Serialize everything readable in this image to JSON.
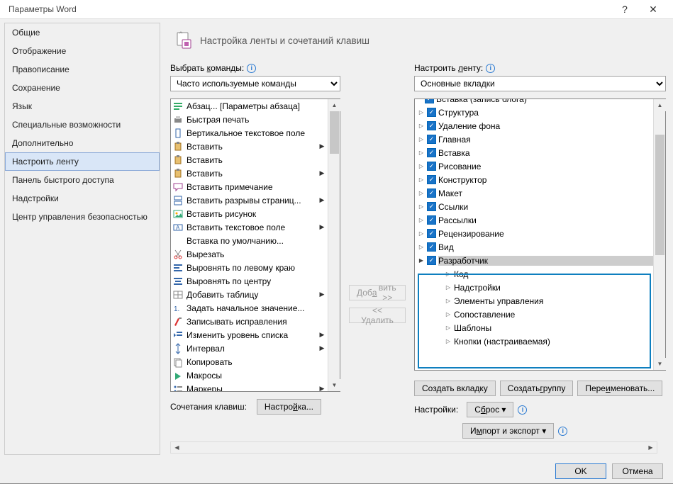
{
  "window": {
    "title": "Параметры Word",
    "help": "?",
    "close": "✕"
  },
  "sidebar": {
    "items": [
      {
        "label": "Общие"
      },
      {
        "label": "Отображение"
      },
      {
        "label": "Правописание"
      },
      {
        "label": "Сохранение"
      },
      {
        "label": "Язык"
      },
      {
        "label": "Специальные возможности"
      },
      {
        "label": "Дополнительно"
      },
      {
        "label": "Настроить ленту"
      },
      {
        "label": "Панель быстрого доступа"
      },
      {
        "label": "Надстройки"
      },
      {
        "label": "Центр управления безопасностью"
      }
    ],
    "selected_index": 7
  },
  "heading": "Настройка ленты и сочетаний клавиш",
  "left": {
    "label_before": "Выбрать ",
    "label_under": "к",
    "label_after": "оманды:",
    "combo": "Часто используемые команды",
    "commands": [
      {
        "icon": "para",
        "label": "Абзац... [Параметры абзаца]"
      },
      {
        "icon": "print",
        "label": "Быстрая печать"
      },
      {
        "icon": "vtext",
        "label": "Вертикальное текстовое поле"
      },
      {
        "icon": "paste",
        "label": "Вставить",
        "hasMenu": true
      },
      {
        "icon": "paste",
        "label": "Вставить"
      },
      {
        "icon": "paste",
        "label": "Вставить",
        "hasMenu": true
      },
      {
        "icon": "comment",
        "label": "Вставить примечание"
      },
      {
        "icon": "pgbreak",
        "label": "Вставить разрывы страниц...",
        "hasMenu": true
      },
      {
        "icon": "img",
        "label": "Вставить рисунок"
      },
      {
        "icon": "textbox",
        "label": "Вставить текстовое поле",
        "hasMenu": true
      },
      {
        "icon": "blank",
        "label": "Вставка по умолчанию..."
      },
      {
        "icon": "cut",
        "label": "Вырезать"
      },
      {
        "icon": "alignl",
        "label": "Выровнять по левому краю"
      },
      {
        "icon": "alignc",
        "label": "Выровнять по центру"
      },
      {
        "icon": "table",
        "label": "Добавить таблицу",
        "hasMenu": true
      },
      {
        "icon": "num",
        "label": "Задать начальное значение..."
      },
      {
        "icon": "track",
        "label": "Записывать исправления"
      },
      {
        "icon": "indent",
        "label": "Изменить уровень списка",
        "hasMenu": true
      },
      {
        "icon": "spacing",
        "label": "Интервал",
        "hasMenu": true
      },
      {
        "icon": "copy",
        "label": "Копировать"
      },
      {
        "icon": "macro",
        "label": "Макросы"
      },
      {
        "icon": "bullet",
        "label": "Маркеры",
        "hasMenu": true
      }
    ],
    "kb_label": "Сочетания клавиш:",
    "kb_button_before": "Настро",
    "kb_button_under": "й",
    "kb_button_after": "ка..."
  },
  "mid": {
    "add_before": "Доб",
    "add_under": "а",
    "add_after": "вить >>",
    "remove": "<< Удалить"
  },
  "right": {
    "label_before": "Настроить ",
    "label_under": "л",
    "label_after": "енту:",
    "combo": "Основные вкладки",
    "top_partial": "Вставка (запись блога)",
    "tree": [
      {
        "label": "Структура"
      },
      {
        "label": "Удаление фона"
      },
      {
        "label": "Главная"
      },
      {
        "label": "Вставка"
      },
      {
        "label": "Рисование"
      },
      {
        "label": "Конструктор"
      },
      {
        "label": "Макет"
      },
      {
        "label": "Ссылки"
      },
      {
        "label": "Рассылки"
      },
      {
        "label": "Рецензирование"
      },
      {
        "label": "Вид"
      }
    ],
    "selected": {
      "label": "Разработчик",
      "children": [
        "Код",
        "Надстройки",
        "Элементы управления",
        "Сопоставление",
        "Шаблоны",
        "Кнопки (настраиваемая)"
      ]
    },
    "btn1_before": "Создать вкла",
    "btn1_under": "д",
    "btn1_after": "ку",
    "btn2_before": "Создать ",
    "btn2_under": "г",
    "btn2_after": "руппу",
    "btn3_before": "Пере",
    "btn3_under": "и",
    "btn3_after": "меновать...",
    "settings_label": "Настройки:",
    "reset_before": "С",
    "reset_under": "б",
    "reset_after": "рос ▾",
    "import_before": "И",
    "import_under": "м",
    "import_after": "порт и экспорт ▾"
  },
  "footer": {
    "ok": "OK",
    "cancel": "Отмена"
  }
}
